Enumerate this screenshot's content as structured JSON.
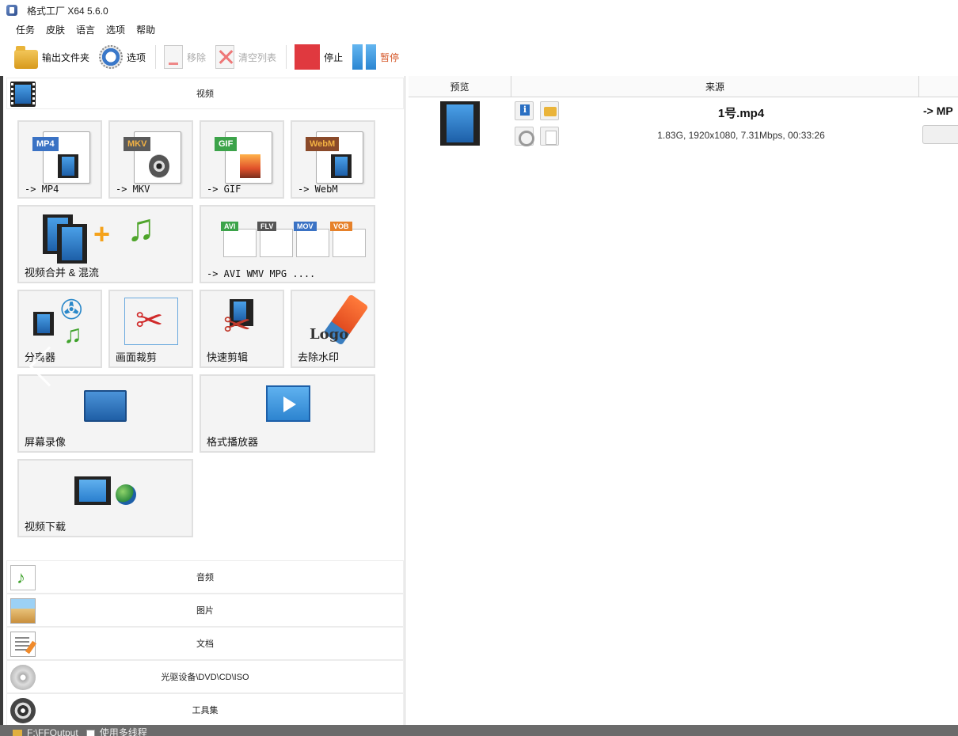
{
  "window": {
    "title": "格式工厂 X64 5.6.0"
  },
  "menu": [
    "任务",
    "皮肤",
    "语言",
    "选项",
    "帮助"
  ],
  "toolbar": {
    "output_folder": "输出文件夹",
    "options": "选项",
    "remove": "移除",
    "clear_list": "清空列表",
    "stop": "停止",
    "pause": "暂停"
  },
  "categories": {
    "video": "视频",
    "audio": "音频",
    "picture": "图片",
    "document": "文档",
    "disc": "光驱设备\\DVD\\CD\\ISO",
    "tools": "工具集"
  },
  "video_tiles": {
    "mp4": {
      "label": "-> MP4",
      "tag": "MP4"
    },
    "mkv": {
      "label": "-> MKV",
      "tag": "MKV"
    },
    "gif": {
      "label": "-> GIF",
      "tag": "GIF"
    },
    "webm": {
      "label": "-> WebM",
      "tag": "WebM"
    },
    "merge": {
      "label": "视频合并 & 混流"
    },
    "more": {
      "label": "-> AVI WMV MPG ....",
      "tags": [
        "AVI",
        "FLV",
        "MOV",
        "VOB"
      ]
    },
    "splitter": {
      "label": "分离器"
    },
    "crop": {
      "label": "画面裁剪"
    },
    "quick_cut": {
      "label": "快速剪辑"
    },
    "remove_watermark": {
      "label": "去除水印",
      "logo_text": "Logo"
    },
    "screen_record": {
      "label": "屏幕录像"
    },
    "player": {
      "label": "格式播放器"
    },
    "download": {
      "label": "视频下载"
    }
  },
  "task_list": {
    "columns": {
      "preview": "预览",
      "source": "来源"
    },
    "rows": [
      {
        "filename": "1号.mp4",
        "info": "1.83G, 1920x1080, 7.31Mbps, 00:33:26",
        "output": "-> MP"
      }
    ]
  },
  "status": {
    "output_path": "F:\\FFOutput",
    "multithread_label": "使用多线程"
  },
  "colors": {
    "stop_red": "#e0393f",
    "pause_blue": "#3a8fd8",
    "pause_label": "#d65a2c",
    "status_bar": "#6b6b6b"
  }
}
